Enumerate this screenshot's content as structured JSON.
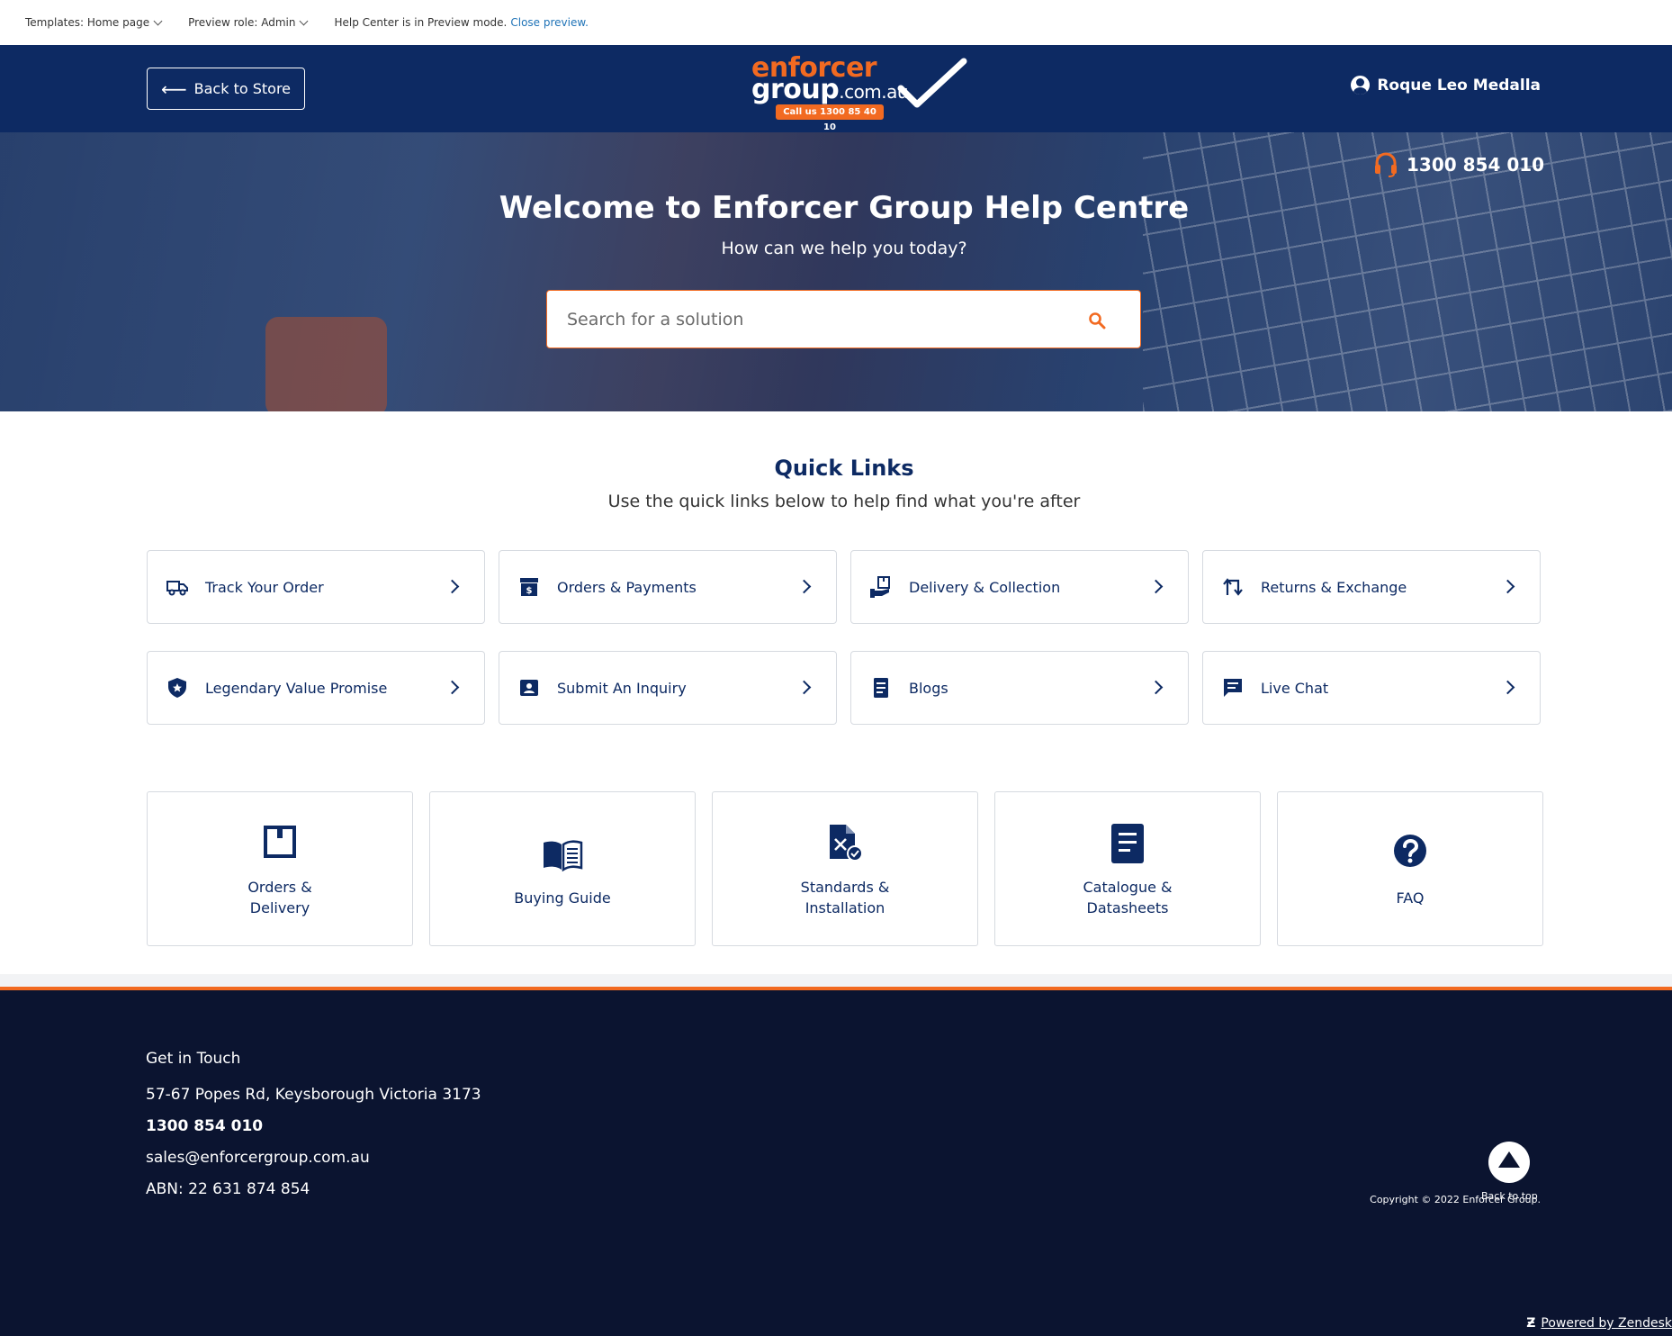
{
  "preview_bar": {
    "templates": "Templates: Home page",
    "role": "Preview role: Admin",
    "mode_text": "Help Center is in Preview mode.",
    "close_link": "Close preview."
  },
  "header": {
    "back_label": "Back to Store",
    "logo_line1": "enforcer",
    "logo_line2": "group",
    "logo_domain": ".com.au",
    "logo_call": "Call us 1300 85 40 10",
    "user_name": "Roque Leo Medalla"
  },
  "hero": {
    "phone": "1300 854 010",
    "title": "Welcome to Enforcer Group Help Centre",
    "subtitle": "How can we help you today?",
    "search_placeholder": "Search for a solution"
  },
  "quick_links": {
    "title": "Quick Links",
    "subtitle": "Use the quick links below to help find what you're after",
    "items": [
      {
        "label": "Track Your Order",
        "icon": "truck-icon"
      },
      {
        "label": "Orders & Payments",
        "icon": "archive-dollar-icon"
      },
      {
        "label": "Delivery & Collection",
        "icon": "hand-box-icon"
      },
      {
        "label": "Returns & Exchange",
        "icon": "swap-arrows-icon"
      },
      {
        "label": "Legendary Value Promise",
        "icon": "shield-star-icon"
      },
      {
        "label": "Submit An Inquiry",
        "icon": "contact-card-icon"
      },
      {
        "label": "Blogs",
        "icon": "document-icon"
      },
      {
        "label": "Live Chat",
        "icon": "chat-icon"
      }
    ]
  },
  "categories": [
    {
      "line1": "Orders &",
      "line2": "Delivery",
      "icon": "box-icon"
    },
    {
      "line1": "Buying Guide",
      "line2": "",
      "icon": "open-book-icon"
    },
    {
      "line1": "Standards &",
      "line2": "Installation",
      "icon": "tools-document-icon"
    },
    {
      "line1": "Catalogue &",
      "line2": "Datasheets",
      "icon": "datasheet-icon"
    },
    {
      "line1": "FAQ",
      "line2": "",
      "icon": "question-icon"
    }
  ],
  "footer": {
    "heading": "Get in Touch",
    "address": "57-67 Popes Rd, Keysborough Victoria 3173",
    "phone": "1300 854 010",
    "email": "sales@enforcergroup.com.au",
    "abn": "ABN: 22 631 874 854",
    "back_to_top": "Back to top",
    "copyright": "Copyright © 2022 Enforcer Group.",
    "powered": "Powered by Zendesk"
  },
  "colors": {
    "navy": "#0d2a63",
    "orange": "#f26a21",
    "footer_bg": "#0b1430"
  }
}
